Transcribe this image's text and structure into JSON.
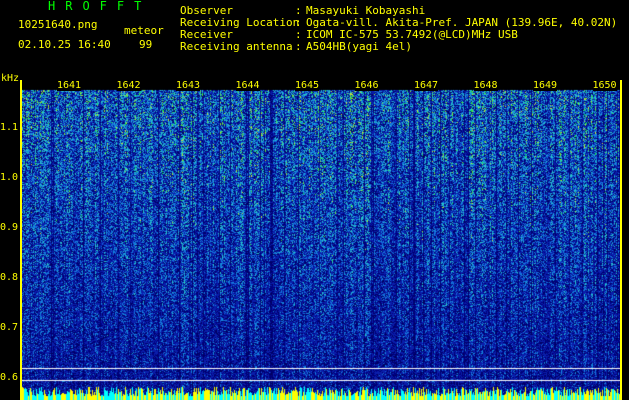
{
  "header": {
    "logo": "HROFFT",
    "filename": "10251640.png",
    "datetime": "02.10.25 16:40",
    "meteor_label": "meteor",
    "meteor_count": "99",
    "fields": [
      {
        "label": "Observer",
        "value": "Masayuki Kobayashi"
      },
      {
        "label": "Receiving Location",
        "value": "Ogata-vill. Akita-Pref. JAPAN (139.96E, 40.02N)"
      },
      {
        "label": "Receiver",
        "value": "ICOM IC-575 53.7492(@LCD)MHz USB"
      },
      {
        "label": "Receiving antenna",
        "value": "A504HB(yagi 4el)"
      }
    ],
    "separator": ":"
  },
  "spectrogram": {
    "y_unit": "kHz",
    "y_ticks": [
      "1.1",
      "1.0",
      "0.9",
      "0.8",
      "0.7",
      "0.6"
    ],
    "x_ticks": [
      "1641",
      "1642",
      "1643",
      "1644",
      "1645",
      "1646",
      "1647",
      "1648",
      "1649",
      "1650"
    ],
    "colors": {
      "background": "#000000",
      "label": "#ffff00",
      "logo": "#00ff00"
    }
  }
}
